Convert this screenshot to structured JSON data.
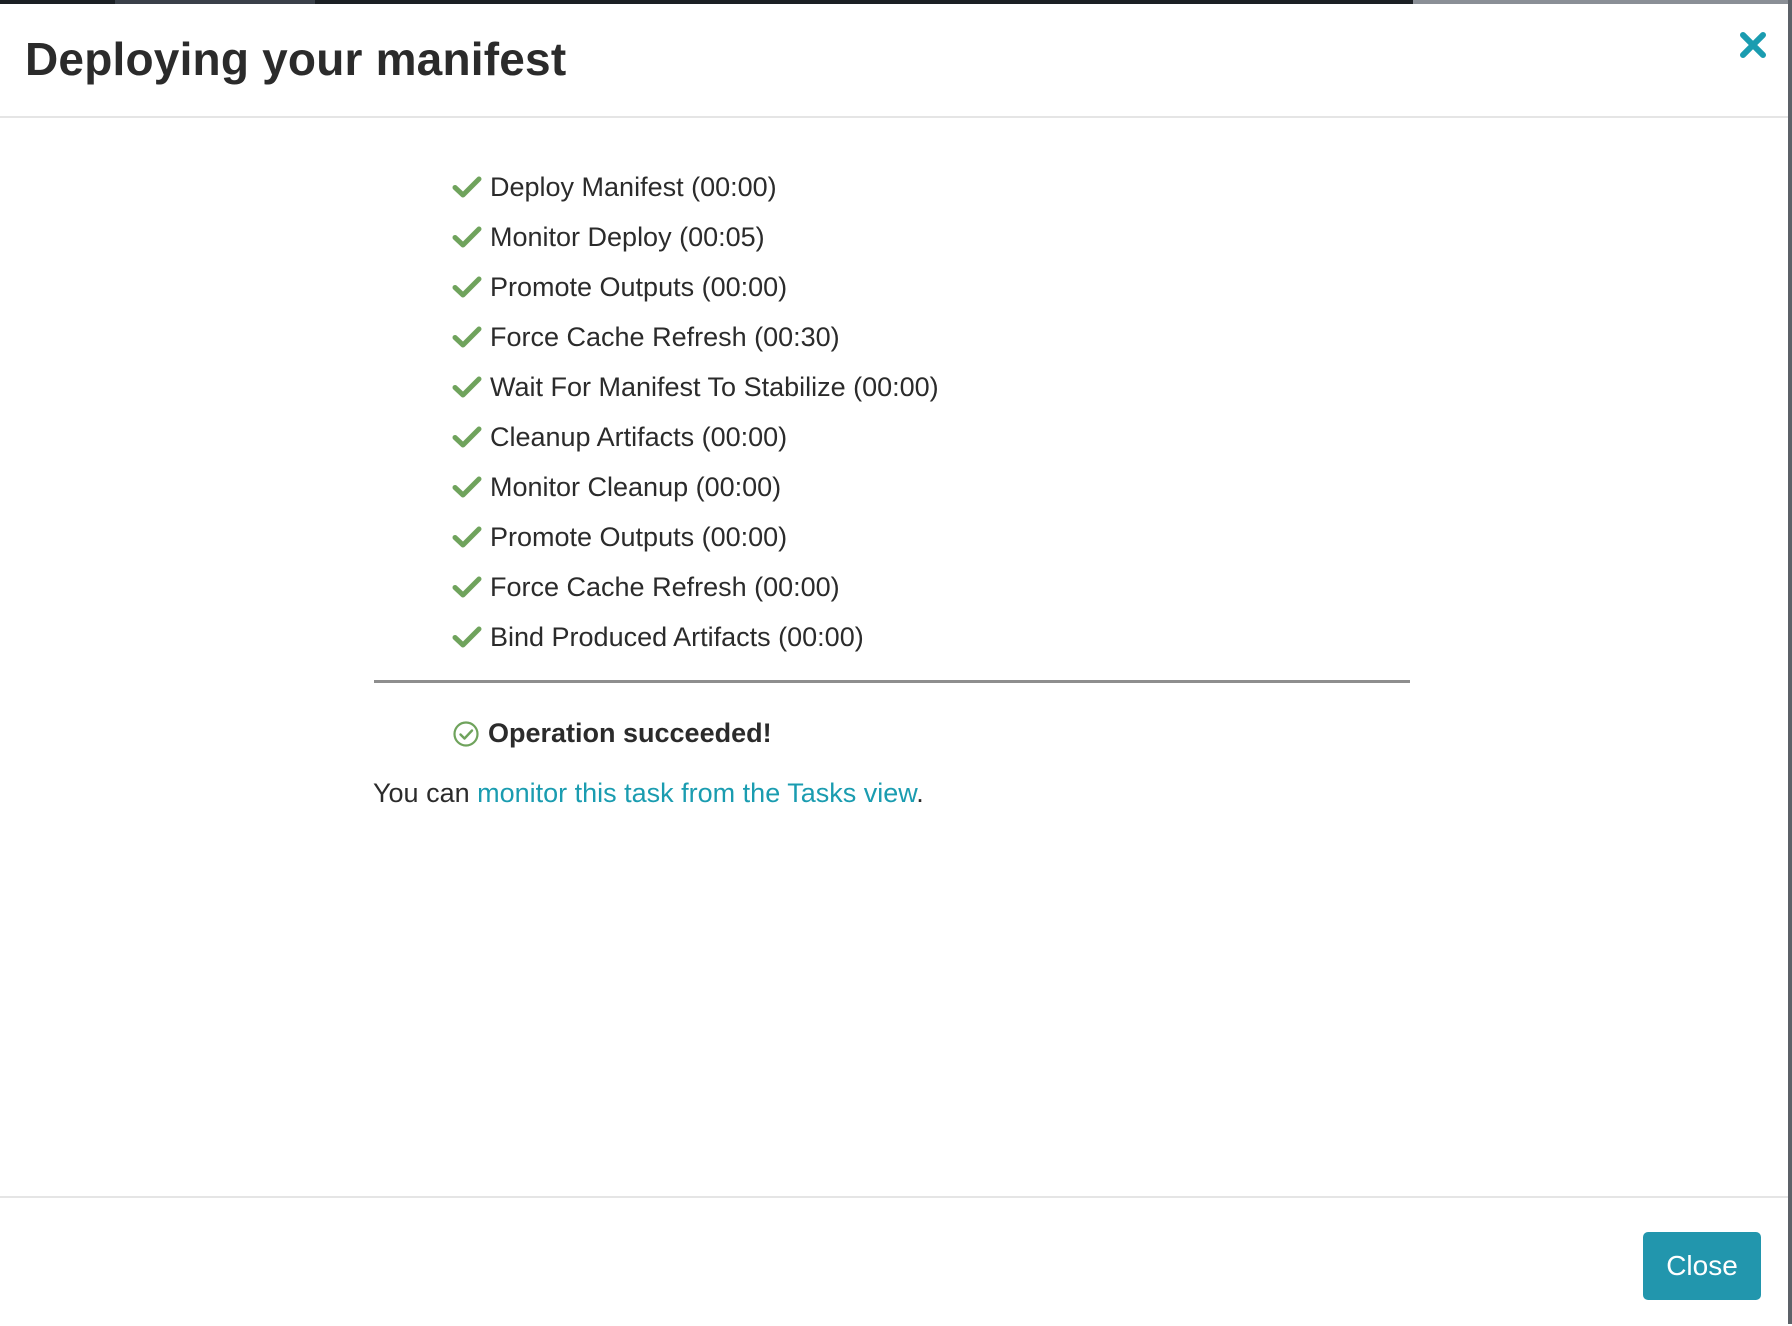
{
  "modal": {
    "title": "Deploying your manifest",
    "close_icon": "close-icon"
  },
  "steps": [
    {
      "label": "Deploy Manifest (00:00)",
      "status": "done"
    },
    {
      "label": "Monitor Deploy (00:05)",
      "status": "done"
    },
    {
      "label": "Promote Outputs (00:00)",
      "status": "done"
    },
    {
      "label": "Force Cache Refresh (00:30)",
      "status": "done"
    },
    {
      "label": "Wait For Manifest To Stabilize (00:00)",
      "status": "done"
    },
    {
      "label": "Cleanup Artifacts (00:00)",
      "status": "done"
    },
    {
      "label": "Monitor Cleanup (00:00)",
      "status": "done"
    },
    {
      "label": "Promote Outputs (00:00)",
      "status": "done"
    },
    {
      "label": "Force Cache Refresh (00:00)",
      "status": "done"
    },
    {
      "label": "Bind Produced Artifacts (00:00)",
      "status": "done"
    }
  ],
  "result": {
    "message": "Operation succeeded!",
    "icon": "circle-check-icon"
  },
  "monitor": {
    "prefix": "You can ",
    "link_text": "monitor this task from the Tasks view",
    "suffix": "."
  },
  "footer": {
    "close_label": "Close"
  },
  "colors": {
    "accent": "#2296ad",
    "link": "#1a9cb0",
    "success": "#6fa35c",
    "text": "#2b2b2b"
  }
}
